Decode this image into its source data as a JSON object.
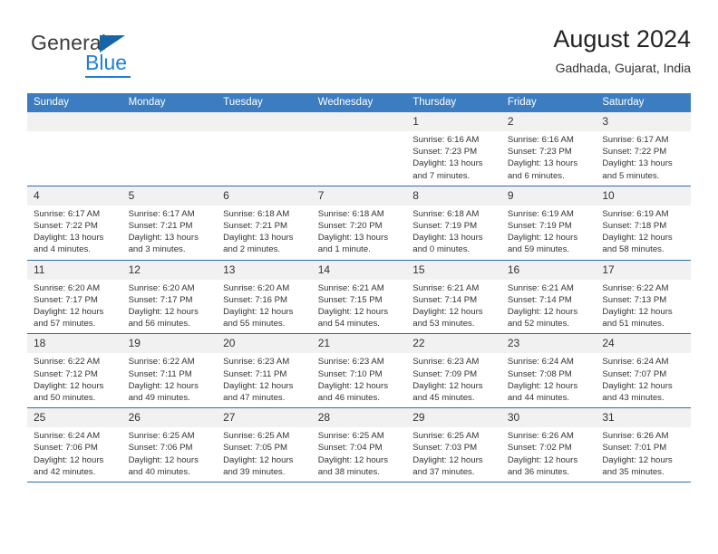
{
  "brand": {
    "name_top": "General",
    "name_bottom": "Blue",
    "accent_color": "#1f7fd4",
    "triangle_color": "#1565a8"
  },
  "header": {
    "title": "August 2024",
    "subtitle": "Gadhada, Gujarat, India"
  },
  "theme": {
    "header_row_bg": "#3b7dc0",
    "daynum_bg": "#f1f1f1",
    "row_border": "#2f6cad",
    "text": "#333333"
  },
  "weekdays": [
    "Sunday",
    "Monday",
    "Tuesday",
    "Wednesday",
    "Thursday",
    "Friday",
    "Saturday"
  ],
  "weeks": [
    [
      {
        "day": "",
        "empty": true
      },
      {
        "day": "",
        "empty": true
      },
      {
        "day": "",
        "empty": true
      },
      {
        "day": "",
        "empty": true
      },
      {
        "day": "1",
        "sunrise": "Sunrise: 6:16 AM",
        "sunset": "Sunset: 7:23 PM",
        "daylight_line1": "Daylight: 13 hours",
        "daylight_line2": "and 7 minutes."
      },
      {
        "day": "2",
        "sunrise": "Sunrise: 6:16 AM",
        "sunset": "Sunset: 7:23 PM",
        "daylight_line1": "Daylight: 13 hours",
        "daylight_line2": "and 6 minutes."
      },
      {
        "day": "3",
        "sunrise": "Sunrise: 6:17 AM",
        "sunset": "Sunset: 7:22 PM",
        "daylight_line1": "Daylight: 13 hours",
        "daylight_line2": "and 5 minutes."
      }
    ],
    [
      {
        "day": "4",
        "sunrise": "Sunrise: 6:17 AM",
        "sunset": "Sunset: 7:22 PM",
        "daylight_line1": "Daylight: 13 hours",
        "daylight_line2": "and 4 minutes."
      },
      {
        "day": "5",
        "sunrise": "Sunrise: 6:17 AM",
        "sunset": "Sunset: 7:21 PM",
        "daylight_line1": "Daylight: 13 hours",
        "daylight_line2": "and 3 minutes."
      },
      {
        "day": "6",
        "sunrise": "Sunrise: 6:18 AM",
        "sunset": "Sunset: 7:21 PM",
        "daylight_line1": "Daylight: 13 hours",
        "daylight_line2": "and 2 minutes."
      },
      {
        "day": "7",
        "sunrise": "Sunrise: 6:18 AM",
        "sunset": "Sunset: 7:20 PM",
        "daylight_line1": "Daylight: 13 hours",
        "daylight_line2": "and 1 minute."
      },
      {
        "day": "8",
        "sunrise": "Sunrise: 6:18 AM",
        "sunset": "Sunset: 7:19 PM",
        "daylight_line1": "Daylight: 13 hours",
        "daylight_line2": "and 0 minutes."
      },
      {
        "day": "9",
        "sunrise": "Sunrise: 6:19 AM",
        "sunset": "Sunset: 7:19 PM",
        "daylight_line1": "Daylight: 12 hours",
        "daylight_line2": "and 59 minutes."
      },
      {
        "day": "10",
        "sunrise": "Sunrise: 6:19 AM",
        "sunset": "Sunset: 7:18 PM",
        "daylight_line1": "Daylight: 12 hours",
        "daylight_line2": "and 58 minutes."
      }
    ],
    [
      {
        "day": "11",
        "sunrise": "Sunrise: 6:20 AM",
        "sunset": "Sunset: 7:17 PM",
        "daylight_line1": "Daylight: 12 hours",
        "daylight_line2": "and 57 minutes."
      },
      {
        "day": "12",
        "sunrise": "Sunrise: 6:20 AM",
        "sunset": "Sunset: 7:17 PM",
        "daylight_line1": "Daylight: 12 hours",
        "daylight_line2": "and 56 minutes."
      },
      {
        "day": "13",
        "sunrise": "Sunrise: 6:20 AM",
        "sunset": "Sunset: 7:16 PM",
        "daylight_line1": "Daylight: 12 hours",
        "daylight_line2": "and 55 minutes."
      },
      {
        "day": "14",
        "sunrise": "Sunrise: 6:21 AM",
        "sunset": "Sunset: 7:15 PM",
        "daylight_line1": "Daylight: 12 hours",
        "daylight_line2": "and 54 minutes."
      },
      {
        "day": "15",
        "sunrise": "Sunrise: 6:21 AM",
        "sunset": "Sunset: 7:14 PM",
        "daylight_line1": "Daylight: 12 hours",
        "daylight_line2": "and 53 minutes."
      },
      {
        "day": "16",
        "sunrise": "Sunrise: 6:21 AM",
        "sunset": "Sunset: 7:14 PM",
        "daylight_line1": "Daylight: 12 hours",
        "daylight_line2": "and 52 minutes."
      },
      {
        "day": "17",
        "sunrise": "Sunrise: 6:22 AM",
        "sunset": "Sunset: 7:13 PM",
        "daylight_line1": "Daylight: 12 hours",
        "daylight_line2": "and 51 minutes."
      }
    ],
    [
      {
        "day": "18",
        "sunrise": "Sunrise: 6:22 AM",
        "sunset": "Sunset: 7:12 PM",
        "daylight_line1": "Daylight: 12 hours",
        "daylight_line2": "and 50 minutes."
      },
      {
        "day": "19",
        "sunrise": "Sunrise: 6:22 AM",
        "sunset": "Sunset: 7:11 PM",
        "daylight_line1": "Daylight: 12 hours",
        "daylight_line2": "and 49 minutes."
      },
      {
        "day": "20",
        "sunrise": "Sunrise: 6:23 AM",
        "sunset": "Sunset: 7:11 PM",
        "daylight_line1": "Daylight: 12 hours",
        "daylight_line2": "and 47 minutes."
      },
      {
        "day": "21",
        "sunrise": "Sunrise: 6:23 AM",
        "sunset": "Sunset: 7:10 PM",
        "daylight_line1": "Daylight: 12 hours",
        "daylight_line2": "and 46 minutes."
      },
      {
        "day": "22",
        "sunrise": "Sunrise: 6:23 AM",
        "sunset": "Sunset: 7:09 PM",
        "daylight_line1": "Daylight: 12 hours",
        "daylight_line2": "and 45 minutes."
      },
      {
        "day": "23",
        "sunrise": "Sunrise: 6:24 AM",
        "sunset": "Sunset: 7:08 PM",
        "daylight_line1": "Daylight: 12 hours",
        "daylight_line2": "and 44 minutes."
      },
      {
        "day": "24",
        "sunrise": "Sunrise: 6:24 AM",
        "sunset": "Sunset: 7:07 PM",
        "daylight_line1": "Daylight: 12 hours",
        "daylight_line2": "and 43 minutes."
      }
    ],
    [
      {
        "day": "25",
        "sunrise": "Sunrise: 6:24 AM",
        "sunset": "Sunset: 7:06 PM",
        "daylight_line1": "Daylight: 12 hours",
        "daylight_line2": "and 42 minutes."
      },
      {
        "day": "26",
        "sunrise": "Sunrise: 6:25 AM",
        "sunset": "Sunset: 7:06 PM",
        "daylight_line1": "Daylight: 12 hours",
        "daylight_line2": "and 40 minutes."
      },
      {
        "day": "27",
        "sunrise": "Sunrise: 6:25 AM",
        "sunset": "Sunset: 7:05 PM",
        "daylight_line1": "Daylight: 12 hours",
        "daylight_line2": "and 39 minutes."
      },
      {
        "day": "28",
        "sunrise": "Sunrise: 6:25 AM",
        "sunset": "Sunset: 7:04 PM",
        "daylight_line1": "Daylight: 12 hours",
        "daylight_line2": "and 38 minutes."
      },
      {
        "day": "29",
        "sunrise": "Sunrise: 6:25 AM",
        "sunset": "Sunset: 7:03 PM",
        "daylight_line1": "Daylight: 12 hours",
        "daylight_line2": "and 37 minutes."
      },
      {
        "day": "30",
        "sunrise": "Sunrise: 6:26 AM",
        "sunset": "Sunset: 7:02 PM",
        "daylight_line1": "Daylight: 12 hours",
        "daylight_line2": "and 36 minutes."
      },
      {
        "day": "31",
        "sunrise": "Sunrise: 6:26 AM",
        "sunset": "Sunset: 7:01 PM",
        "daylight_line1": "Daylight: 12 hours",
        "daylight_line2": "and 35 minutes."
      }
    ]
  ]
}
